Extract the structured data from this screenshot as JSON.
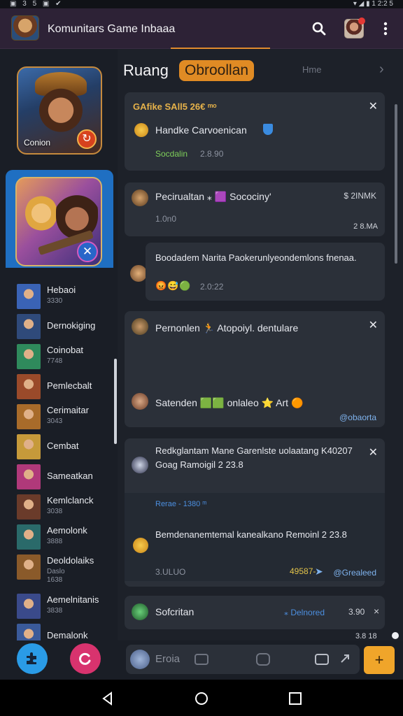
{
  "status": {
    "left": "▣ 3 5 ▣ ✔",
    "right": "▾ ◢ ▮ 1 2:2 5"
  },
  "appbar": {
    "title": "Komunitars Game Inbaaa"
  },
  "sidebar": {
    "featured": [
      {
        "name": "Conion",
        "badge": "↻"
      },
      {
        "name": "",
        "badge": "✕"
      }
    ],
    "items": [
      {
        "name": "Hebaoi",
        "sub": "3330",
        "color": "#3a63b5"
      },
      {
        "name": "Dernokiging",
        "sub": "",
        "color": "#2f4a7a"
      },
      {
        "name": "Coinobat",
        "sub": "7748",
        "color": "#2f8a5c"
      },
      {
        "name": "Pemlecbalt",
        "sub": "",
        "color": "#9a4a2a"
      },
      {
        "name": "Cerimaitar",
        "sub": "3043",
        "color": "#a86b2a"
      },
      {
        "name": "Cembat",
        "sub": "",
        "color": "#c69a3a"
      },
      {
        "name": "Sameatkan",
        "sub": "",
        "color": "#b0397a"
      },
      {
        "name": "Kemlclanck",
        "sub": "3038",
        "color": "#6a3b2a"
      },
      {
        "name": "Aemolonk",
        "sub": "3888",
        "color": "#2a6a6a"
      },
      {
        "name": "Deoldolaiks",
        "sub": "Daslo",
        "sub2": "1638",
        "color": "#8a5a2a"
      },
      {
        "name": "Aemelnitanis",
        "sub": "3838",
        "color": "#3a4a8a"
      },
      {
        "name": "Demalonk",
        "sub": "",
        "color": "#3a5a9a"
      }
    ]
  },
  "room": {
    "title": "Ruang",
    "pill": "Obroollan",
    "home": "Hme",
    "next": "›"
  },
  "messages": {
    "m1": {
      "header": "GAfike SAll5 26€ ᵐᵒ",
      "text": "Handke Carvoenican",
      "status": "Socdalin",
      "time": "2.8.90"
    },
    "m2": {
      "text": "Pecirualtan ⁎ 🟪 Socociny'",
      "right": "$ 2INMK",
      "sub": "1.0n0",
      "time": "2 8.MA"
    },
    "m3": {
      "text": "Boodadem Narita Paokerunlyeondemlons fnenaa.",
      "emoji": "😡😅🟢",
      "time": "2.0:22"
    },
    "m4": {
      "text": "Pernonlen 🏃 Atopoiyl. dentulare",
      "line2": "Satenden 🟩🟩 onlaleo ⭐ Art 🟠",
      "link": "@obaorta"
    },
    "m5": {
      "text": "Redkglantam Mane Garenlste uolaatang K40207 Goag Ramoigil 2 23.8",
      "p1": "Rerae - 1380 ᵐ",
      "text2": "Bemdenanemtemal kanealkano Remoinl 2 23.8",
      "time": "3.ULUO",
      "yellow": "49587-",
      "link": "@Grealeed"
    },
    "m6": {
      "text": "Sofcritan",
      "r1": "⁎ Delnored",
      "r2": "3.90",
      "r3": "×"
    }
  },
  "bottom_ts": "3.8 18",
  "composer": {
    "placeholder": "Eroia",
    "send": "+"
  },
  "colors": {
    "accent": "#e08b24",
    "appbar": "#2d2236",
    "card": "#2b3039",
    "bg": "#1d2129"
  }
}
